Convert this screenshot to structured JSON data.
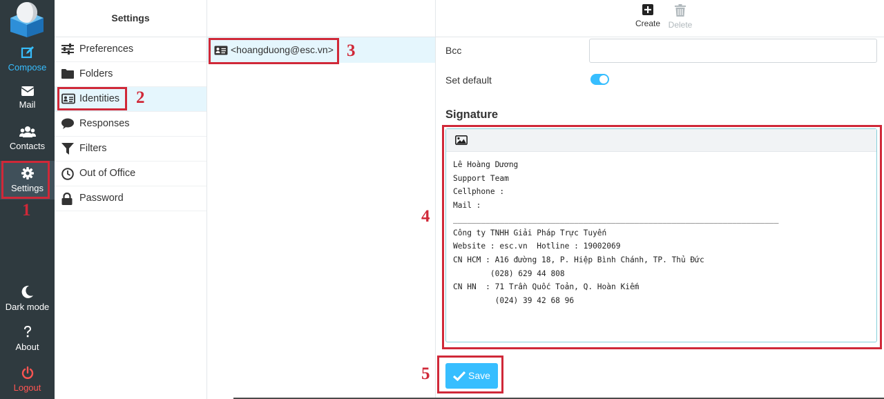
{
  "nav": {
    "compose": "Compose",
    "mail": "Mail",
    "contacts": "Contacts",
    "settings": "Settings",
    "dark_mode": "Dark mode",
    "about": "About",
    "logout": "Logout"
  },
  "settings": {
    "title": "Settings",
    "items": [
      {
        "label": "Preferences",
        "icon": "sliders-icon"
      },
      {
        "label": "Folders",
        "icon": "folder-icon"
      },
      {
        "label": "Identities",
        "icon": "id-card-icon"
      },
      {
        "label": "Responses",
        "icon": "comment-icon"
      },
      {
        "label": "Filters",
        "icon": "filter-icon"
      },
      {
        "label": "Out of Office",
        "icon": "clock-icon"
      },
      {
        "label": "Password",
        "icon": "lock-icon"
      }
    ],
    "selected": "Identities"
  },
  "identities": {
    "items": [
      "<hoangduong@esc.vn>"
    ]
  },
  "toolbar": {
    "create": "Create",
    "delete": "Delete"
  },
  "form": {
    "bcc_label": "Bcc",
    "bcc_value": "",
    "set_default_label": "Set default",
    "set_default_on": true,
    "signature_title": "Signature",
    "signature_lines": [
      "Lê Hoàng Dương",
      "Support Team",
      "Cellphone :",
      "Mail :",
      "______________________________________________________________________",
      "Công ty TNHH Giải Pháp Trực Tuyến",
      "Website : esc.vn  Hotline : 19002069",
      "CN HCM : A16 đường 18, P. Hiệp Bình Chánh, TP. Thủ Đức",
      "        (028) 629 44 808",
      "CN HN  : 71 Trần Quốc Toản, Q. Hoàn Kiếm",
      "         (024) 39 42 68 96"
    ],
    "save_label": "Save"
  },
  "annotations": [
    "1",
    "2",
    "3",
    "4",
    "5"
  ],
  "colors": {
    "accent": "#37beff",
    "nav_bg": "#2f3a3f",
    "logout": "#ff5552",
    "annotation": "#d02838",
    "selected_bg": "#e5f6fd"
  }
}
